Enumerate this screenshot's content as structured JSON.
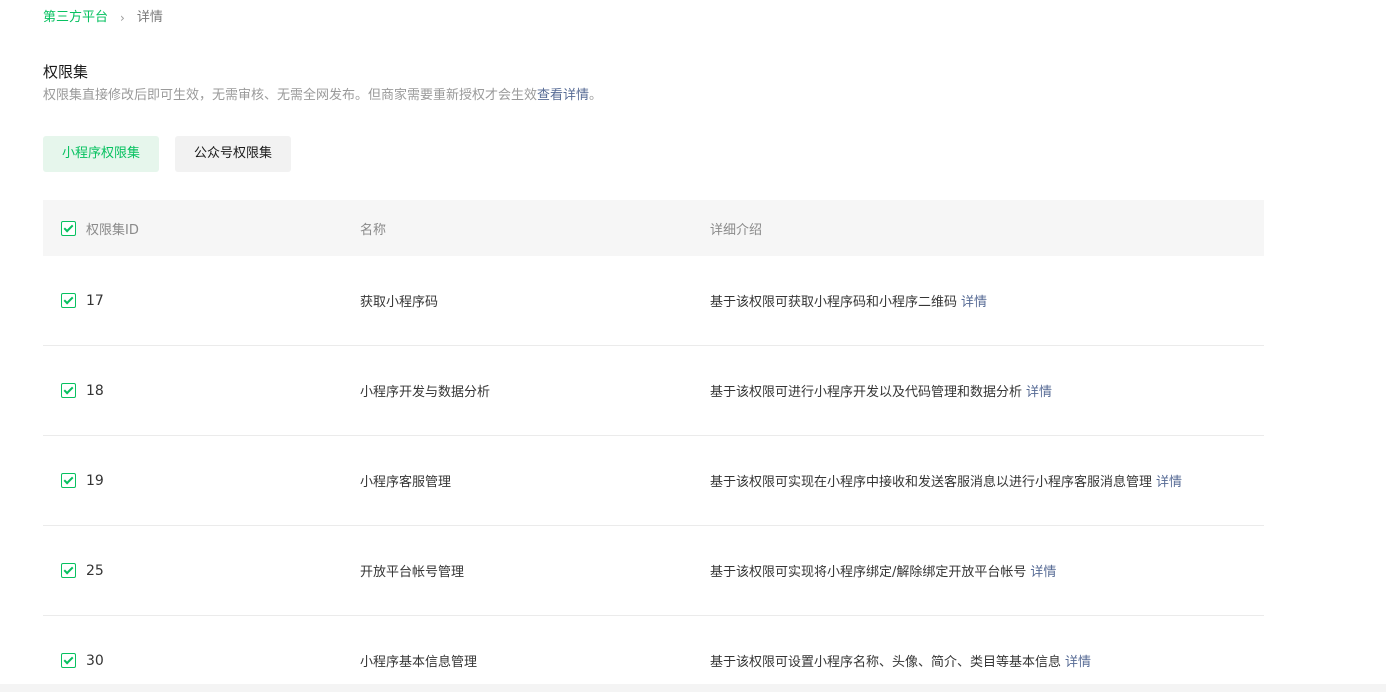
{
  "breadcrumb": {
    "parent": "第三方平台",
    "separator": "›",
    "current": "详情"
  },
  "section": {
    "title": "权限集",
    "description": "权限集直接修改后即可生效，无需审核、无需全网发布。但商家需要重新授权才会生效",
    "description_link": "查看详情",
    "description_end": "。"
  },
  "tabs": [
    {
      "label": "小程序权限集",
      "active": true
    },
    {
      "label": "公众号权限集",
      "active": false
    }
  ],
  "table": {
    "columns": {
      "id": "权限集ID",
      "name": "名称",
      "desc": "详细介绍"
    },
    "detail_label": "详情",
    "rows": [
      {
        "id": "17",
        "name": "获取小程序码",
        "desc": "基于该权限可获取小程序码和小程序二维码",
        "checked": true
      },
      {
        "id": "18",
        "name": "小程序开发与数据分析",
        "desc": "基于该权限可进行小程序开发以及代码管理和数据分析",
        "checked": true
      },
      {
        "id": "19",
        "name": "小程序客服管理",
        "desc": "基于该权限可实现在小程序中接收和发送客服消息以进行小程序客服消息管理",
        "checked": true
      },
      {
        "id": "25",
        "name": "开放平台帐号管理",
        "desc": "基于该权限可实现将小程序绑定/解除绑定开放平台帐号",
        "checked": true
      },
      {
        "id": "30",
        "name": "小程序基本信息管理",
        "desc": "基于该权限可设置小程序名称、头像、简介、类目等基本信息",
        "checked": true
      }
    ]
  },
  "colors": {
    "accent": "#07c160",
    "link": "#576b95",
    "muted": "#9a9a9a"
  }
}
